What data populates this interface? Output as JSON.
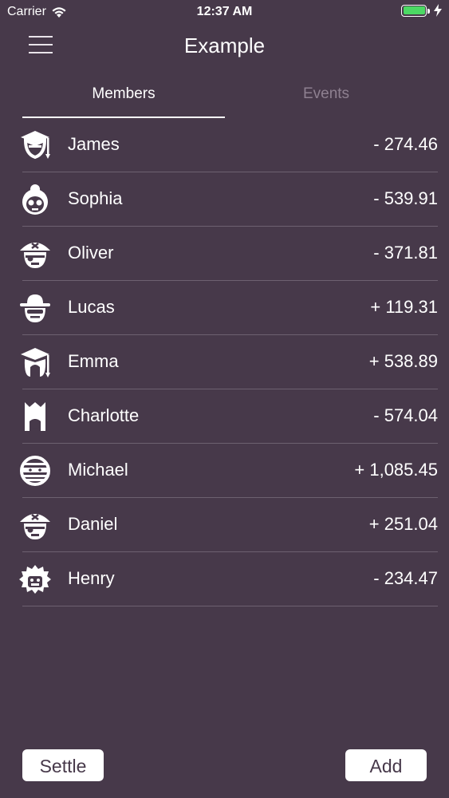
{
  "status_bar": {
    "carrier": "Carrier",
    "time": "12:37 AM",
    "battery_color": "#4cd964"
  },
  "nav": {
    "title": "Example",
    "menu_icon": "hamburger-menu-icon"
  },
  "tabs": [
    {
      "label": "Members",
      "selected": true
    },
    {
      "label": "Events",
      "selected": false
    }
  ],
  "members": [
    {
      "name": "James",
      "balance": "- 274.46",
      "icon": "graduate-avatar-icon"
    },
    {
      "name": "Sophia",
      "balance": "- 539.91",
      "icon": "grandma-avatar-icon"
    },
    {
      "name": "Oliver",
      "balance": "- 371.81",
      "icon": "pirate-avatar-icon"
    },
    {
      "name": "Lucas",
      "balance": "+ 119.31",
      "icon": "spy-avatar-icon"
    },
    {
      "name": "Emma",
      "balance": "+ 538.89",
      "icon": "graduate-girl-avatar-icon"
    },
    {
      "name": "Charlotte",
      "balance": "- 574.04",
      "icon": "princess-avatar-icon"
    },
    {
      "name": "Michael",
      "balance": "+ 1,085.45",
      "icon": "mummy-avatar-icon"
    },
    {
      "name": "Daniel",
      "balance": "+ 251.04",
      "icon": "pirate-avatar-icon"
    },
    {
      "name": "Henry",
      "balance": "- 234.47",
      "icon": "wild-hair-avatar-icon"
    }
  ],
  "buttons": {
    "settle_label": "Settle",
    "add_label": "Add"
  },
  "colors": {
    "background": "#47394a",
    "divider": "#6d6170",
    "inactive_tab": "#8e8090"
  }
}
